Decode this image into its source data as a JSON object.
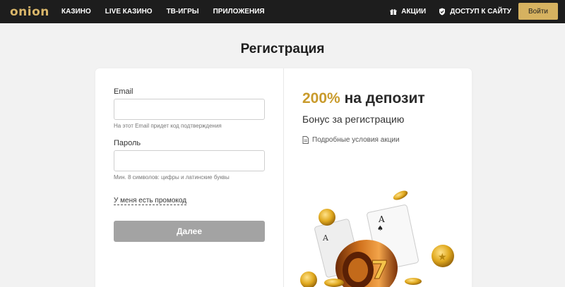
{
  "header": {
    "logo": "onion",
    "nav": [
      "КАЗИНО",
      "LIVE КАЗИНО",
      "ТВ-ИГРЫ",
      "ПРИЛОЖЕНИЯ"
    ],
    "promos_label": "АКЦИИ",
    "access_label": "ДОСТУП К САЙТУ",
    "login_label": "Войти"
  },
  "page": {
    "title": "Регистрация"
  },
  "form": {
    "email_label": "Email",
    "email_value": "",
    "email_hint": "На этот Email придет код подтверждения",
    "password_label": "Пароль",
    "password_value": "",
    "password_hint": "Мин. 8 символов: цифры и латинские буквы",
    "promo_link": "У меня есть промокод",
    "submit_label": "Далее"
  },
  "promo": {
    "bonus_accent": "200%",
    "bonus_rest": "на депозит",
    "bonus_sub": "Бонус за регистрацию",
    "terms_link": "Подробные условия акции"
  },
  "colors": {
    "header_bg": "#1d1d1d",
    "accent_gold": "#d6b260",
    "button_disabled": "#a3a3a3",
    "page_bg": "#f2f2f2"
  },
  "icons": [
    "gift-icon",
    "shield-icon",
    "document-icon"
  ]
}
